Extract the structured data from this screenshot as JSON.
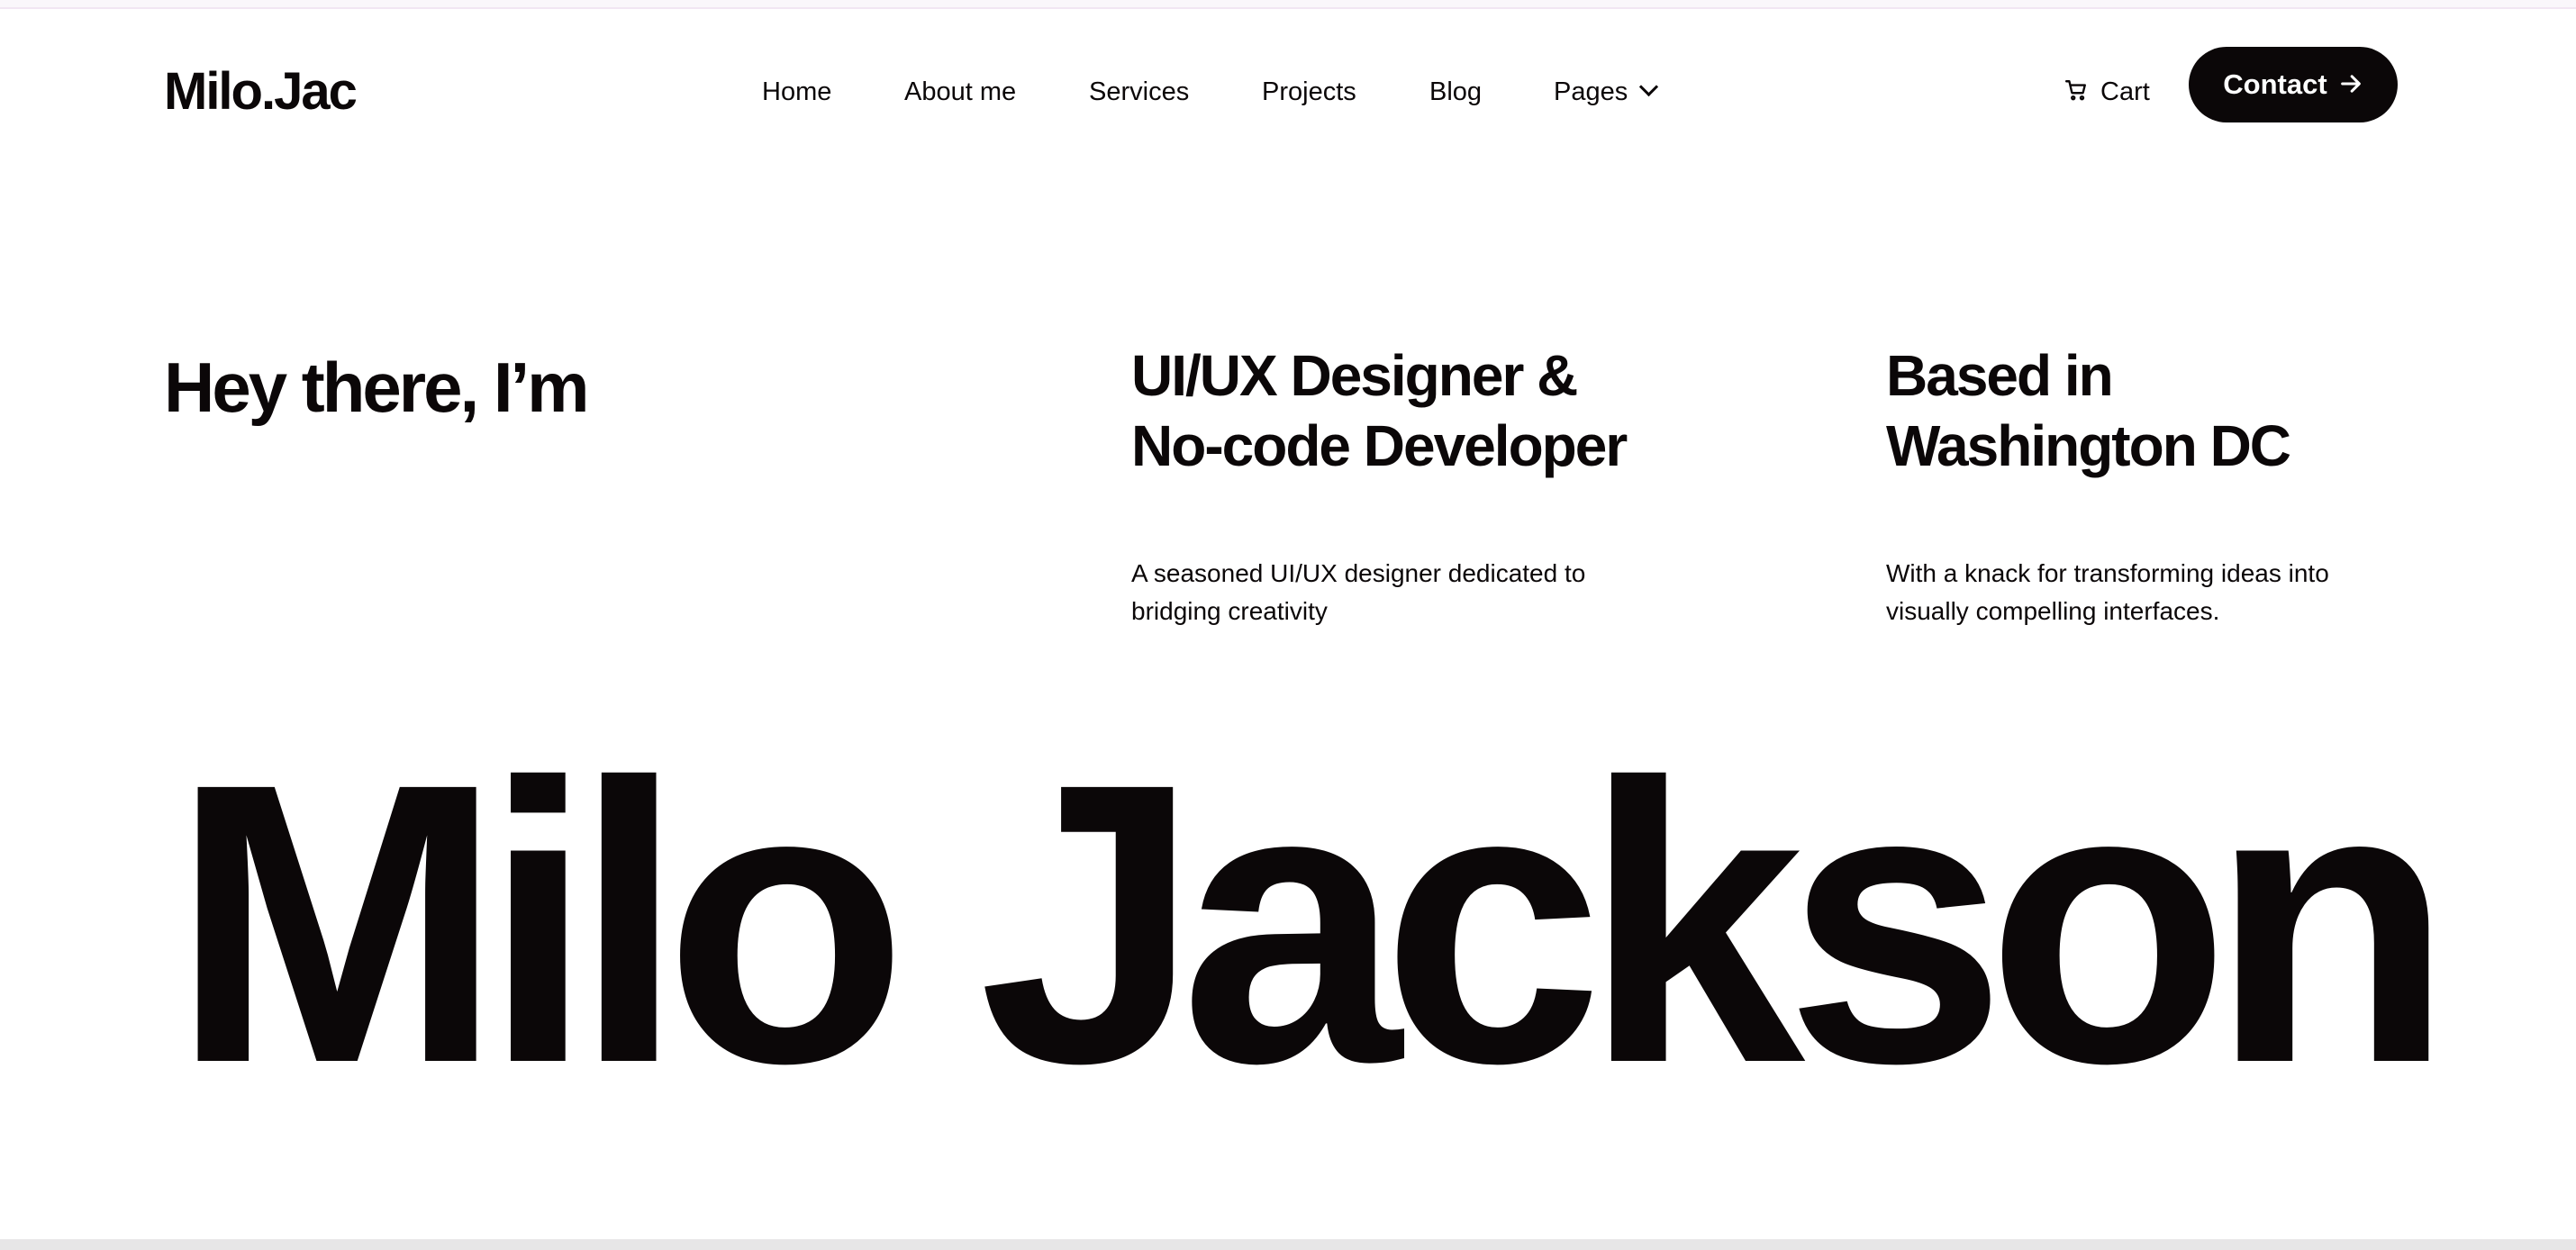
{
  "header": {
    "logo": "Milo.Jac",
    "nav": [
      {
        "label": "Home"
      },
      {
        "label": "About me"
      },
      {
        "label": "Services"
      },
      {
        "label": "Projects"
      },
      {
        "label": "Blog"
      },
      {
        "label": "Pages",
        "icon": "chevron-down-icon"
      }
    ],
    "cart_label": "Cart",
    "cart_icon": "cart-icon",
    "contact_label": "Contact",
    "contact_icon": "arrow-right-icon"
  },
  "hero": {
    "intro": "Hey there, I’m",
    "role": {
      "title_line1": "UI/UX Designer &",
      "title_line2": "No-code Developer",
      "description": "A seasoned UI/UX designer dedicated to bridging creativity"
    },
    "location": {
      "title_line1": "Based in",
      "title_line2": "Washington DC",
      "description": "With a knack for transforming ideas into visually compelling interfaces."
    },
    "name": "Milo Jackson"
  },
  "colors": {
    "text": "#0b0708",
    "background": "#ffffff",
    "button_bg": "#0b0708",
    "button_text": "#ffffff"
  }
}
